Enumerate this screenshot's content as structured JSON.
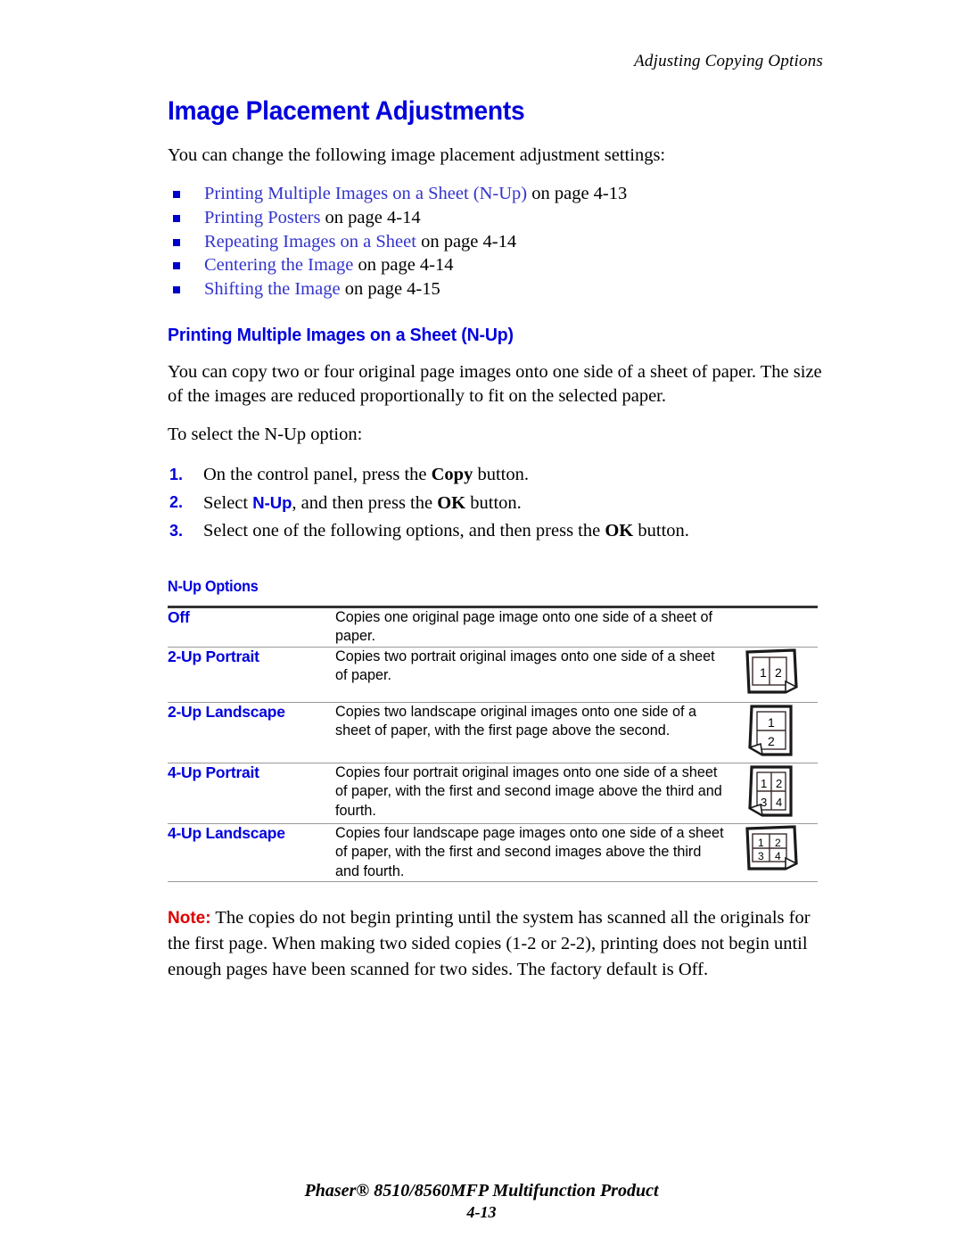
{
  "header": {
    "running_head": "Adjusting Copying Options"
  },
  "main": {
    "title": "Image Placement Adjustments",
    "intro": "You can change the following image placement adjustment settings:",
    "links": [
      {
        "link": "Printing Multiple Images on a Sheet (N-Up)",
        "tail": " on page 4-13"
      },
      {
        "link": "Printing Posters",
        "tail": " on page 4-14"
      },
      {
        "link": "Repeating Images on a Sheet",
        "tail": " on page 4-14"
      },
      {
        "link": "Centering the Image",
        "tail": " on page 4-14"
      },
      {
        "link": "Shifting the Image",
        "tail": " on page 4-15"
      }
    ],
    "subtitle": "Printing Multiple Images on a Sheet (N-Up)",
    "paragraph": "You can copy two or four original page images onto one side of a sheet of paper. The size of the images are reduced proportionally to fit on the selected paper.",
    "lead_in": "To select the N-Up option:",
    "steps": [
      {
        "num": "1.",
        "pre": "On the control panel, press the ",
        "bold": "Copy",
        "post": " button."
      },
      {
        "num": "2.",
        "pre": "Select ",
        "blue": "N-Up",
        "mid": ", and then press the ",
        "bold": "OK",
        "post": " button."
      },
      {
        "num": "3.",
        "pre": "Select one of the following options, and then press the ",
        "bold": "OK",
        "post": " button."
      }
    ]
  },
  "table": {
    "caption": "N-Up Options",
    "rows": [
      {
        "label": "Off",
        "description": "Copies one original page image onto one side of a sheet of paper.",
        "figure": "none"
      },
      {
        "label": "2-Up Portrait",
        "description": "Copies two portrait original images onto one side of a sheet of paper.",
        "figure": "sheet-2up-portrait",
        "cells": [
          "1",
          "2"
        ]
      },
      {
        "label": "2-Up Landscape",
        "description": "Copies two landscape original images onto one side of a sheet of paper, with the first page above the second.",
        "figure": "sheet-2up-landscape",
        "cells": [
          "1",
          "2"
        ]
      },
      {
        "label": "4-Up Portrait",
        "description": "Copies four portrait original images onto one side of a sheet of paper, with the first and second image above the third and fourth.",
        "figure": "sheet-4up-portrait",
        "cells": [
          "1",
          "2",
          "3",
          "4"
        ]
      },
      {
        "label": "4-Up Landscape",
        "description": "Copies four landscape page images onto one side of a sheet of paper, with the first and second images above the third and fourth.",
        "figure": "sheet-4up-landscape",
        "cells": [
          "1",
          "2",
          "3",
          "4"
        ]
      }
    ]
  },
  "note": {
    "label": "Note:",
    "text": " The copies do not begin printing until the system has scanned all the originals for the first page. When making two sided copies (1-2 or 2-2), printing does not begin until enough pages have been scanned for two sides. The factory default is Off."
  },
  "footer": {
    "product": "Phaser® 8510/8560MFP Multifunction Product",
    "page": "4-13"
  },
  "colors": {
    "heading_blue": "#0000dd",
    "link_blue": "#3333cc",
    "note_red": "#dd0000",
    "rule_dark": "#333333",
    "rule_light": "#999999"
  }
}
